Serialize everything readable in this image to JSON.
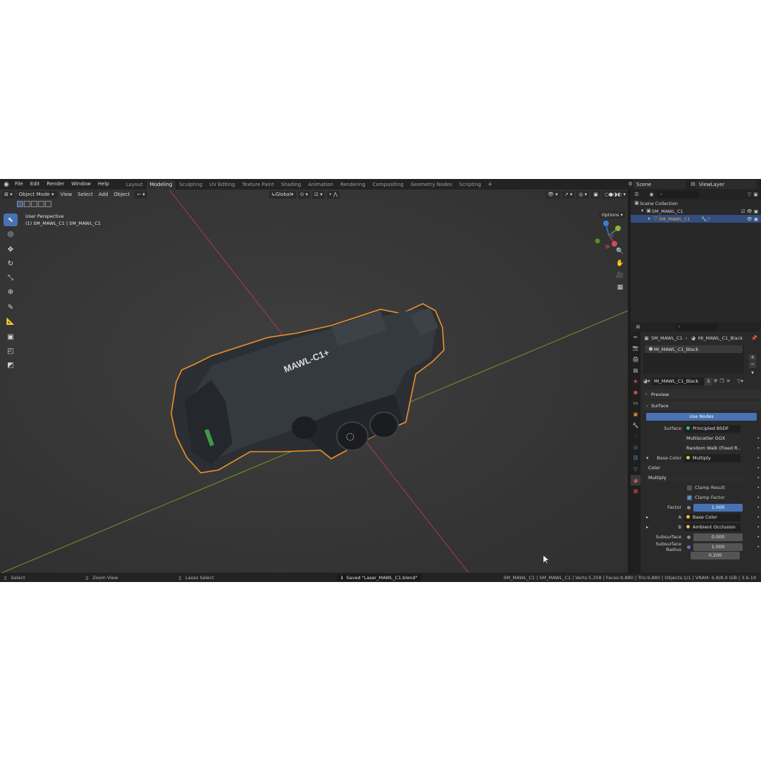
{
  "menu": [
    "File",
    "Edit",
    "Render",
    "Window",
    "Help"
  ],
  "workspaces": [
    "Layout",
    "Modeling",
    "Sculpting",
    "UV Editing",
    "Texture Paint",
    "Shading",
    "Animation",
    "Rendering",
    "Compositing",
    "Geometry Nodes",
    "Scripting"
  ],
  "active_workspace": "Modeling",
  "scene": "Scene",
  "view_layer": "ViewLayer",
  "viewport": {
    "mode": "Object Mode",
    "menus": [
      "View",
      "Select",
      "Add",
      "Object"
    ],
    "orientation": "Global",
    "overlay_line1": "User Perspective",
    "overlay_line2": "(1) SM_MAWL_C1 | SM_MAWL_C1",
    "options": "Options",
    "model_text": "MAWL-C1+"
  },
  "outliner": {
    "root": "Scene Collection",
    "collection": "SM_MAWL_C1",
    "object": "SM_MAWL_C1"
  },
  "properties": {
    "crumb_object": "SM_MAWL_C1",
    "crumb_material": "MI_MAWL_C1_Black",
    "slot": "MI_MAWL_C1_Black",
    "material_name": "MI_MAWL_C1_Black",
    "users": "5",
    "preview": "Preview",
    "surface_panel": "Surface",
    "use_nodes": "Use Nodes",
    "surface_label": "Surface",
    "surface_value": "Principled BSDF",
    "distribution": "Multiscatter GGX",
    "subsurface_method": "Random Walk (Fixed R...",
    "base_color_label": "Base Color",
    "base_color_value": "Multiply",
    "color_mode": "Color",
    "blend_mode": "Multiply",
    "clamp_result": "Clamp Result",
    "clamp_factor": "Clamp Factor",
    "factor_label": "Factor",
    "factor_value": "1.000",
    "a_label": "A",
    "a_value": "Base Color",
    "b_label": "B",
    "b_value": "Ambient Occlusion",
    "subsurface_label": "Subsurface",
    "subsurface_value": "0.000",
    "subsurface_radius_label": "Subsurface Radius",
    "radius_1": "1.000",
    "radius_2": "0.200"
  },
  "status": {
    "select": "Select",
    "zoom": "Zoom View",
    "lasso": "Lasso Select",
    "saved": "Saved \"Laser_MAWL_C1.blend\"",
    "stats": "SM_MAWL_C1 | SM_MAWL_C1 | Verts:5,358 | Faces:9,880 | Tris:9,880 | Objects:1/1 | VRAM: 6.8/8.0 GiB | 3.6.19"
  },
  "colors": {
    "accent": "#4772b3",
    "selection_outline": "#f0902a",
    "axis_x": "#b03a48",
    "axis_y": "#6f9a2a"
  }
}
